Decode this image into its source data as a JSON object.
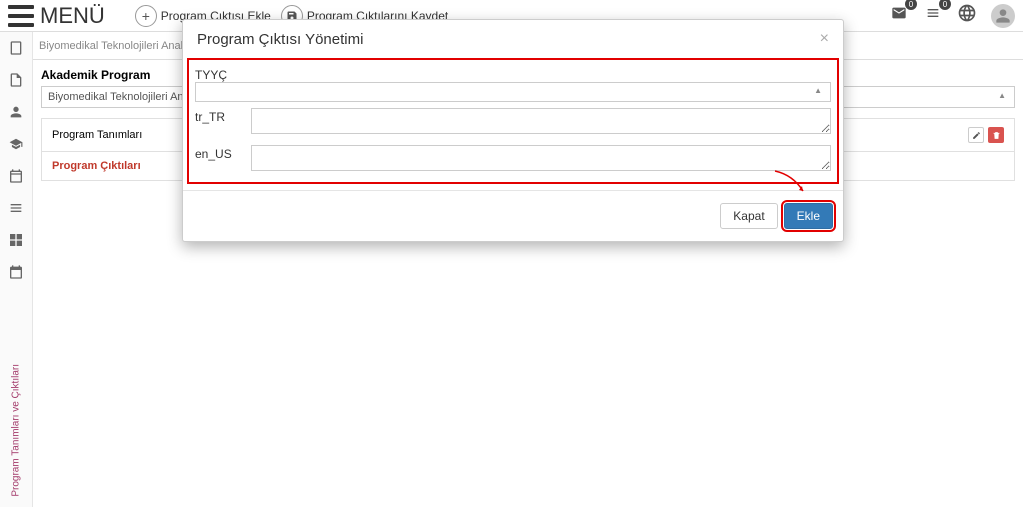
{
  "header": {
    "menu_label": "MENÜ",
    "add_output_label": "Program Çıktısı Ekle",
    "save_outputs_label": "Program Çıktılarını Kaydet",
    "mail_badge": "0",
    "list_badge": "0"
  },
  "breadcrumb": {
    "text": "Biyomedikal Teknolojileri Anabilim Dalı / T"
  },
  "main": {
    "section_title": "Akademik Program",
    "program_select": "Biyomedikal Teknolojileri Anabilim Dalı / Tez",
    "tabs": {
      "program_definitions": "Program Tanımları",
      "program_outputs": "Program Çıktıları"
    }
  },
  "sidebar": {
    "vertical_label": "Program Tanımları ve Çıktıları"
  },
  "modal": {
    "title": "Program Çıktısı Yönetimi",
    "fields": {
      "tyyc_label": "TYYÇ",
      "tr_label": "tr_TR",
      "en_label": "en_US",
      "tr_value": "",
      "en_value": ""
    },
    "buttons": {
      "close": "Kapat",
      "add": "Ekle"
    }
  }
}
